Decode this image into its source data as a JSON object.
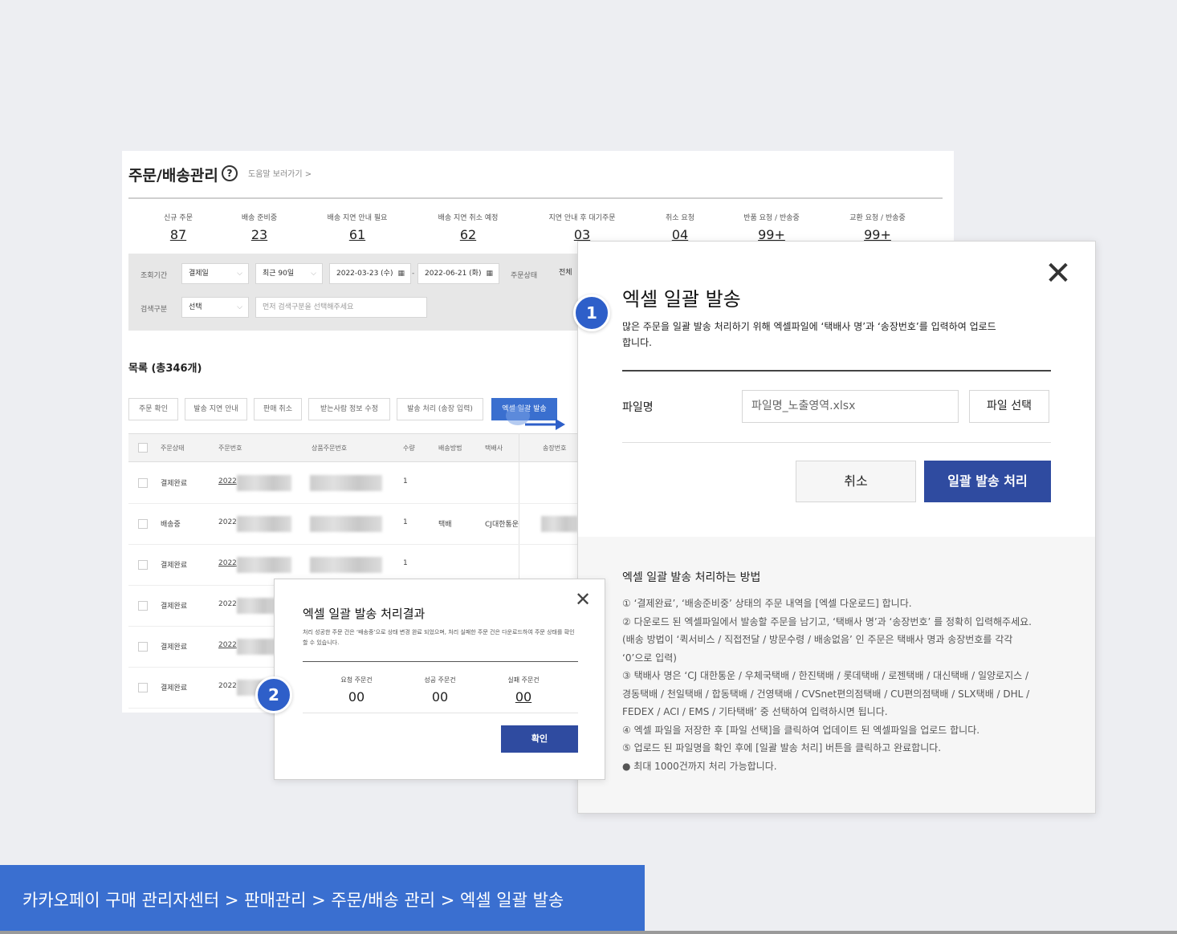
{
  "page": {
    "title": "주문/배송관리",
    "help_link": "도움말 보러가기 >",
    "stats": [
      {
        "label": "신규 주문",
        "count": "87"
      },
      {
        "label": "배송 준비중",
        "count": "23"
      },
      {
        "label": "배송 지연 안내 필요",
        "count": "61"
      },
      {
        "label": "배송 지연 취소 예정",
        "count": "62"
      },
      {
        "label": "지연 안내 후 대기주문",
        "count": "03"
      },
      {
        "label": "취소 요청",
        "count": "04"
      },
      {
        "label": "반품 요청 / 반송중",
        "count": "99+"
      },
      {
        "label": "교환 요청 / 반송중",
        "count": "99+"
      }
    ],
    "filter": {
      "period_label": "조회기간",
      "date_type": "결제일",
      "range": "최근 90일",
      "date_from": "2022-03-23 (수)",
      "date_sep": "-",
      "date_to": "2022-06-21 (화)",
      "status_label": "주문상태",
      "status_value": "전체",
      "search_label": "검색구분",
      "search_type": "선택",
      "search_placeholder": "먼저 검색구분을 선택해주세요"
    },
    "list_title": "목록 (총346개)",
    "actions": [
      "주문 확인",
      "발송 지연 안내",
      "판매 취소",
      "받는사람 정보 수정",
      "발송 처리 (송장 입력)",
      "엑셀 일괄 발송"
    ],
    "columns": [
      "주문상태",
      "주문번호",
      "상품주문번호",
      "수량",
      "배송방법",
      "택배사",
      "송장번호"
    ],
    "rows": [
      {
        "status": "결제완료",
        "order_no": "2022",
        "qty": "1",
        "method": "",
        "courier": ""
      },
      {
        "status": "배송중",
        "order_no": "2022",
        "qty": "1",
        "method": "택배",
        "courier": "CJ대한통운"
      },
      {
        "status": "결제완료",
        "order_no": "2022",
        "qty": "1",
        "method": "",
        "courier": ""
      },
      {
        "status": "결제완료",
        "order_no": "2022",
        "qty": "",
        "method": "",
        "courier": ""
      },
      {
        "status": "결제완료",
        "order_no": "2022",
        "qty": "",
        "method": "",
        "courier": ""
      },
      {
        "status": "결제완료",
        "order_no": "2022",
        "qty": "",
        "method": "",
        "courier": ""
      }
    ]
  },
  "modal_bulk": {
    "title": "엑셀 일괄 발송",
    "description": "많은 주문을 일괄 발송 처리하기 위해 엑셀파일에 ‘택배사 명’과 ‘송장번호’를 입력하여 업로드 합니다.",
    "file_label": "파일명",
    "file_value": "파일명_노출영역.xlsx",
    "file_button": "파일 선택",
    "cancel_button": "취소",
    "submit_button": "일괄 발송 처리",
    "help_title": "엑셀 일괄 발송 처리하는 방법",
    "help_steps": [
      "① ‘결제완료’, ‘배송준비중’ 상태의 주문 내역을 [엑셀 다운로드] 합니다.",
      "② 다운로드 된 엑셀파일에서 발송할 주문을 남기고, ‘택배사 명’과 ‘송장번호’ 를 정확히 입력해주세요.\n     (배송 방법이 ‘퀵서비스 / 직접전달 / 방문수령 / 배송없음’ 인 주문은 택배사 명과 송장번호를 각각\n     ‘0’으로 입력)",
      "③ 택배사 명은 ‘CJ 대한통운 / 우체국택배 / 한진택배 / 롯데택배 / 로젠택배 / 대신택배 / 일양로지스 /\n     경동택배 / 천일택배 / 합동택배 / 건영택배 / CVSnet편의점택배 / CU편의점택배 / SLX택배 / DHL /\n     FEDEX / ACI / EMS / 기타택배’ 중 선택하여 입력하시면 됩니다.",
      "④ 엑셀 파일을 저장한 후 [파일 선택]을 클릭하여 업데이트 된 엑셀파일을 업로드 합니다.",
      "⑤ 업로드 된 파일명을 확인 후에 [일괄 발송 처리] 버튼을 클릭하고 완료합니다.",
      "● 최대 1000건까지 처리 가능합니다."
    ]
  },
  "modal_result": {
    "title": "엑셀 일괄 발송 처리결과",
    "description": "처리 성공한 주문 건은 ‘배송중’으로 상태 변경 완료 되었으며, 처리 실패한 주문 건은 다운로드하여 주문 상태를 확인할 수 있습니다.",
    "requested_label": "요청 주문건",
    "requested_value": "00",
    "success_label": "성공 주문건",
    "success_value": "00",
    "failed_label": "실패 주문건",
    "failed_value": "00",
    "ok_button": "확인"
  },
  "badges": {
    "step1": "1",
    "step2": "2"
  },
  "breadcrumb": "카카오페이 구매 관리자센터 > 판매관리 > 주문/배송 관리 > 엑셀 일괄 발송",
  "colors": {
    "accent": "#3a6fd0",
    "primary_button": "#2f4ba0",
    "badge": "#2e5fc9"
  },
  "icons": {
    "help": "question-circle-icon",
    "close": "close-icon",
    "calendar": "calendar-icon",
    "arrow": "arrow-right-icon"
  }
}
